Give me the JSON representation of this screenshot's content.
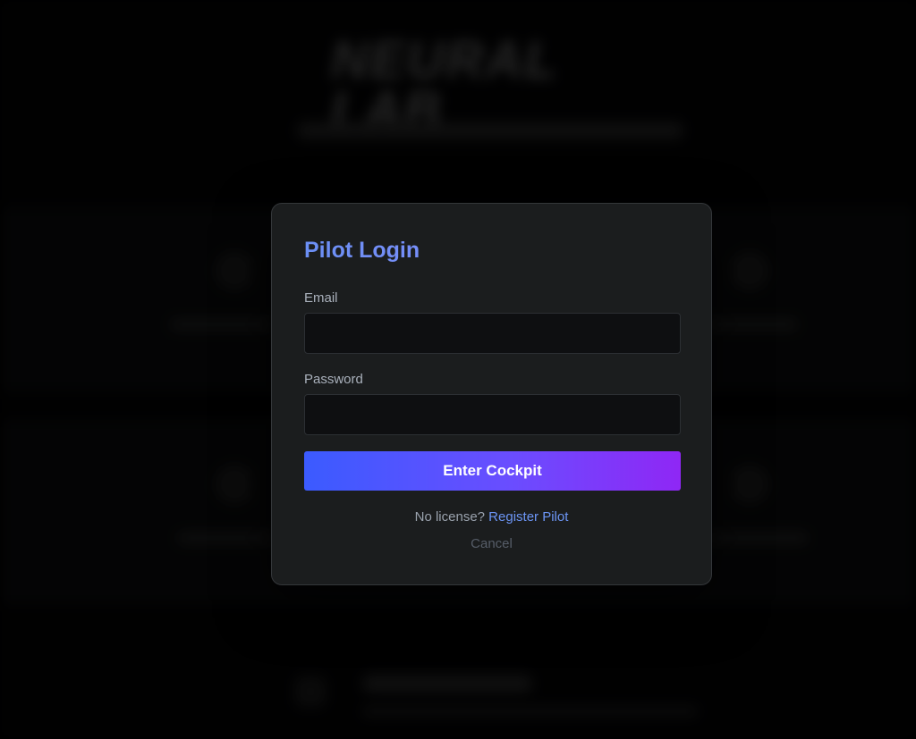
{
  "background": {
    "logo_text": "NEURAL LAB"
  },
  "modal": {
    "title": "Pilot Login",
    "email": {
      "label": "Email",
      "value": "",
      "placeholder": ""
    },
    "password": {
      "label": "Password",
      "value": "",
      "placeholder": ""
    },
    "submit_label": "Enter Cockpit",
    "register_prompt": "No license?",
    "register_link": "Register Pilot",
    "cancel_label": "Cancel"
  },
  "colors": {
    "title_accent": "#6f95ff",
    "button_gradient_start": "#3b5bff",
    "button_gradient_end": "#8f27f5",
    "link": "#6c95f5",
    "modal_bg": "#1b1d1e"
  }
}
